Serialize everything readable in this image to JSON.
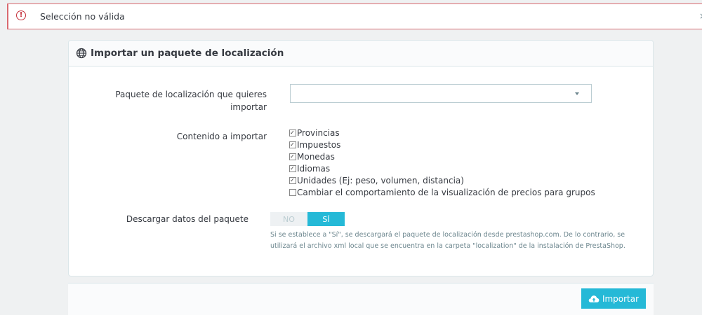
{
  "alert": {
    "message": "Selección no válida",
    "icon": "alert-circle-icon",
    "close": "×"
  },
  "panel": {
    "title": "Importar un paquete de localización",
    "icon": "globe-icon"
  },
  "form": {
    "package_label": "Paquete de localización que quieres importar",
    "package_value": "",
    "content_label": "Contenido a importar",
    "content_items": [
      {
        "label": "Provincias",
        "checked": true
      },
      {
        "label": "Impuestos",
        "checked": true
      },
      {
        "label": "Monedas",
        "checked": true
      },
      {
        "label": "Idiomas",
        "checked": true
      },
      {
        "label": "Unidades (Ej: peso, volumen, distancia)",
        "checked": true
      },
      {
        "label": "Cambiar el comportamiento de la visualización de precios para grupos",
        "checked": false
      }
    ],
    "download_label": "Descargar datos del paquete",
    "switch_no": "NO",
    "switch_si": "SÍ",
    "switch_selected": "SÍ",
    "help_text": "Si se establece a \"Sí\", se descargará el paquete de localización desde prestashop.com. De lo contrario, se utilizará el archivo xml local que se encuentra en la carpeta \"localization\" de la instalación de PrestaShop."
  },
  "footer": {
    "import_label": "Importar",
    "import_icon": "cloud-upload-icon"
  },
  "colors": {
    "accent": "#25b9d7",
    "danger": "#c5303b",
    "background": "#eff1f2"
  }
}
